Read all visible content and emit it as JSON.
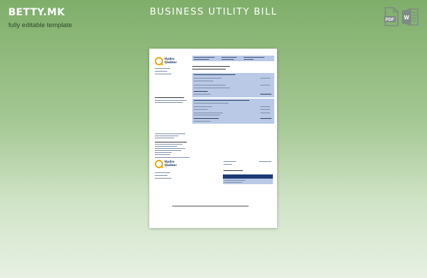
{
  "header": {
    "brand_logo": "BETTY.MK",
    "brand_tagline": "fully editable template",
    "title": "BUSINESS UTILITY BILL"
  },
  "file_formats": [
    {
      "icon": "pdf-file-icon",
      "label": "PDF",
      "color": "#7d8b84"
    },
    {
      "icon": "word-file-icon",
      "label": "W",
      "color": "#7d8b84"
    }
  ],
  "document": {
    "logo_line1": "Hydro",
    "logo_line2": "Québec"
  },
  "colors": {
    "background_top": "#7fae6a",
    "background_bottom": "#e8f1e4",
    "band": "#b9c9e6",
    "bar": "#1c3a75",
    "logo_accent": "#f5a300"
  }
}
